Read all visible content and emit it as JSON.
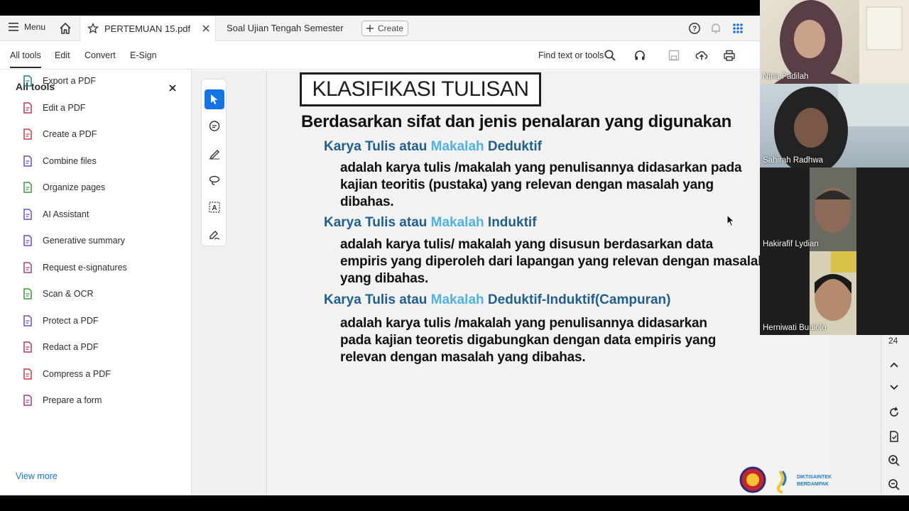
{
  "tabbar": {
    "menu_label": "Menu",
    "active_tab": "PERTEMUAN 15.pdf",
    "second_tab": "Soal Ujian Tengah Semester",
    "create_label": "Create"
  },
  "toolbar": {
    "menus": [
      "All tools",
      "Edit",
      "Convert",
      "E-Sign"
    ],
    "find_label": "Find text or tools"
  },
  "left_panel": {
    "title": "All tools",
    "items": [
      {
        "label": "Export a PDF",
        "icon": "export-pdf-icon",
        "color": "#1f7a8c"
      },
      {
        "label": "Edit a PDF",
        "icon": "edit-pdf-icon",
        "color": "#c4315b"
      },
      {
        "label": "Create a PDF",
        "icon": "create-pdf-icon",
        "color": "#d43a3a"
      },
      {
        "label": "Combine files",
        "icon": "combine-files-icon",
        "color": "#6b4bd6"
      },
      {
        "label": "Organize pages",
        "icon": "organize-pages-icon",
        "color": "#3a9a3a"
      },
      {
        "label": "AI Assistant",
        "icon": "ai-assistant-icon",
        "color": "#6b4bd6"
      },
      {
        "label": "Generative summary",
        "icon": "generative-summary-icon",
        "color": "#6b4bd6"
      },
      {
        "label": "Request e-signatures",
        "icon": "request-esignature-icon",
        "color": "#b0359a"
      },
      {
        "label": "Scan & OCR",
        "icon": "scan-ocr-icon",
        "color": "#3a9a3a"
      },
      {
        "label": "Protect a PDF",
        "icon": "protect-pdf-icon",
        "color": "#6b4bd6"
      },
      {
        "label": "Redact a PDF",
        "icon": "redact-pdf-icon",
        "color": "#c4315b"
      },
      {
        "label": "Compress a PDF",
        "icon": "compress-pdf-icon",
        "color": "#d43a3a"
      },
      {
        "label": "Prepare a form",
        "icon": "prepare-form-icon",
        "color": "#b0359a"
      }
    ],
    "view_more": "View more"
  },
  "slide": {
    "title": "KLASIFIKASI TULISAN",
    "subtitle": "Berdasarkan  sifat dan jenis penalaran  yang digunakan",
    "sections": [
      {
        "heading_a": "Karya Tulis atau ",
        "heading_b": "Makalah",
        "heading_c": " Deduktif",
        "lines": [
          "adalah karya tulis /makalah yang penulisannya didasarkan pada",
          "kajian teoritis (pustaka) yang relevan dengan masalah yang",
          "dibahas."
        ]
      },
      {
        "heading_a": "Karya Tulis atau ",
        "heading_b": "Makalah",
        "heading_c": " Induktif",
        "lines": [
          "adalah karya tulis/ makalah yang disusun berdasarkan data",
          "empiris yang diperoleh dari lapangan yang relevan dengan masalah",
          "yang dibahas."
        ]
      },
      {
        "heading_a": "Karya Tulis atau ",
        "heading_b": "Makalah",
        "heading_c": " Deduktif-Induktif(Campuran)",
        "lines": [
          "adalah karya tulis /makalah yang penulisannya didasarkan",
          "pada kajian teoretis digabungkan dengan data empiris yang",
          "relevan dengan masalah yang dibahas."
        ]
      }
    ],
    "logo_text_1": "DIKTISAINTEK",
    "logo_text_2": "BERDAMPAK"
  },
  "right_rail": {
    "page_number": "24"
  },
  "participants": [
    {
      "name": "Nina Fadilah"
    },
    {
      "name": "Sahirah Radhwa"
    },
    {
      "name": "Hakirafif Lydian"
    },
    {
      "name": "Herniwati Buulolo"
    }
  ],
  "colors": {
    "accent": "#1473e6",
    "heading_dark": "#1f5f8f",
    "heading_light": "#4fb2e3"
  }
}
